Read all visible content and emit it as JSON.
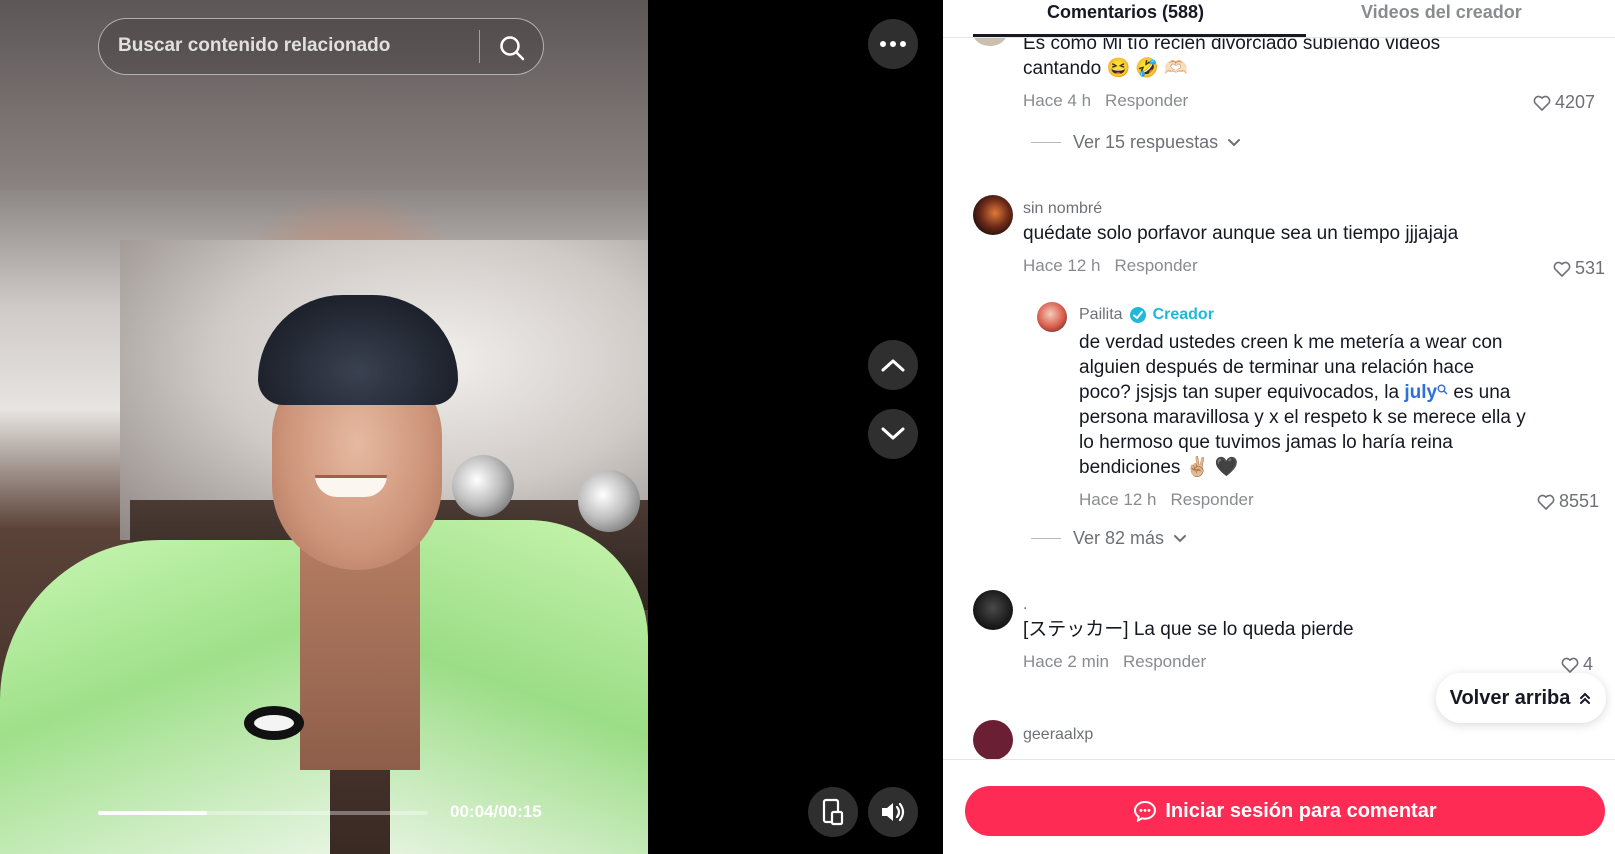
{
  "search": {
    "placeholder": "Buscar contenido relacionado"
  },
  "player": {
    "time": "00:04/00:15",
    "progress": 0.33
  },
  "tabs": {
    "comments": "Comentarios (588)",
    "creator_videos": "Videos del creador"
  },
  "comments": [
    {
      "text_line1": "Es como Mi tío recién divorciado subiendo videos",
      "text_line2": "cantando 😆 🤣 🫶🏻",
      "time": "Hace 4 h",
      "reply": "Responder",
      "likes": "4207",
      "view_replies": "Ver 15 respuestas"
    },
    {
      "user": "sin nombré",
      "text": "quédate solo porfavor aunque sea un tiempo jjjajaja",
      "time": "Hace 12 h",
      "reply": "Responder",
      "likes": "531",
      "creator_reply": {
        "user": "Pailita",
        "badge": "Creador",
        "lines": [
          "de verdad ustedes creen k me metería a wear con",
          "alguien después de terminar una relación hace",
          "poco? jsjsjs tan super equivocados, la",
          "persona maravillosa y x el respeto k se merece ella y",
          "lo hermoso que tuvimos jamas lo haría reina",
          "bendiciones ✌🏼 🖤"
        ],
        "mention": "july",
        "after_mention": " es una",
        "time": "Hace 12 h",
        "reply": "Responder",
        "likes": "8551"
      },
      "view_more": "Ver 82 más"
    },
    {
      "user": ".",
      "text": "[ステッカー] La que se lo queda pierde",
      "time": "Hace 2 min",
      "reply": "Responder",
      "likes": "4"
    },
    {
      "user": "geeraalxp"
    }
  ],
  "back_to_top": "Volver arriba",
  "login_button": "Iniciar sesión para comentar",
  "colors": {
    "accent": "#fe2c55",
    "creator": "#20b8d8",
    "mention": "#2e6fd8"
  }
}
